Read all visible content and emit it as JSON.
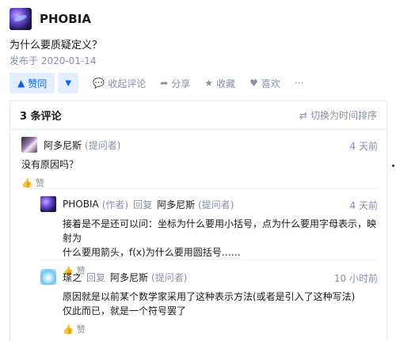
{
  "author": {
    "name": "PHOBIA"
  },
  "question": "为什么要质疑定义？",
  "published": "发布于 2020-01-14",
  "actions": {
    "vote_up": "赞同",
    "collapse": "收起评论",
    "share": "分享",
    "collect": "收藏",
    "like": "喜欢",
    "more": "···"
  },
  "comments_panel": {
    "count": "3 条评论",
    "sort_toggle": "切换为时间排序",
    "items": [
      {
        "name": "阿多尼斯",
        "tag": "(提问者)",
        "time": "4 天前",
        "body": "没有原因吗？",
        "like": "赞"
      },
      {
        "name": "PHOBIA",
        "tag": "(作者)",
        "reply_word": "回复",
        "reply_to": "阿多尼斯",
        "reply_to_tag": "(提问者)",
        "time": "4 天前",
        "body_line1": "接着是不是还可以问：坐标为什么要用小括号，点为什么要用字母表示，映射为",
        "body_line2": "什么要用箭头，f(x)为什么要用圆括号……",
        "like": "赞"
      },
      {
        "name": "瑹之",
        "reply_word": "回复",
        "reply_to": "阿多尼斯",
        "reply_to_tag": "(提问者)",
        "time": "10 小时前",
        "body_line1": "原因就是以前某个数学家采用了这种表示方法(或者是引入了这种写法)",
        "body_line2": "仅此而已，就是一个符号罢了",
        "like": "赞"
      }
    ]
  },
  "colors": {
    "accent": "#0066ff",
    "accent_bg": "#e5eefc",
    "muted": "#8590a6"
  }
}
